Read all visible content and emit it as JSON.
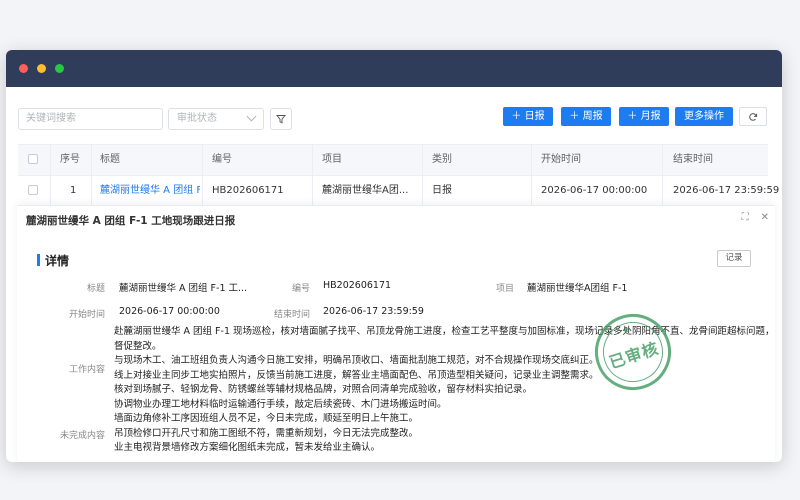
{
  "toolbar": {
    "search_placeholder": "关键词搜索",
    "status_placeholder": "审批状态",
    "btn_daily": "＋ 日报",
    "btn_weekly": "＋ 周报",
    "btn_monthly": "＋ 月报",
    "btn_more": "更多操作"
  },
  "table": {
    "headers": [
      "序号",
      "标题",
      "编号",
      "项目",
      "类别",
      "开始时间",
      "结束时间"
    ],
    "rows": [
      {
        "index": "1",
        "title": "麓湖丽世缦华 A 团组 F",
        "code": "HB202606171",
        "project": "麓湖丽世缦华A团...",
        "category": "日报",
        "start": "2026-06-17 00:00:00",
        "end": "2026-06-17 23:59:59"
      }
    ]
  },
  "panel": {
    "title": "麓湖丽世缦华 A 团组 F-1 工地现场跟进日报",
    "section": "详情",
    "record_button": "记录",
    "fields": {
      "title_label": "标题",
      "title_value": "麓湖丽世缦华 A 团组 F-1 工...",
      "code_label": "编号",
      "code_value": "HB202606171",
      "project_label": "项目",
      "project_value": "麓湖丽世缦华A团组 F-1",
      "start_label": "开始时间",
      "start_value": "2026-06-17 00:00:00",
      "end_label": "结束时间",
      "end_value": "2026-06-17 23:59:59",
      "content_label": "工作内容",
      "unfinished_label": "未完成内容"
    },
    "content_lines": [
      "赴麓湖丽世缦华 A 团组 F-1 现场巡检，核对墙面腻子找平、吊顶龙骨施工进度，检查工艺平整度与加固标准，现场记录多处阴阳角不直、龙骨间距超标问题，同步",
      "督促整改。",
      "与现场木工、油工班组负责人沟通今日施工安排，明确吊顶收口、墙面批刮施工规范，对不合规操作现场交底纠正。",
      "线上对接业主同步工地实拍照片，反馈当前施工进度，解答业主墙面配色、吊顶造型相关疑问，记录业主调整需求。",
      "核对到场腻子、轻钢龙骨、防锈螺丝等辅材规格品牌，对照合同清单完成验收，留存材料实拍记录。",
      "协调物业办理工地材料临时运输通行手续，敲定后续瓷砖、木门进场搬运时间。"
    ],
    "unfinished_lines": [
      "墙面边角修补工序因班组人员不足，今日未完成，顺延至明日上午施工。",
      "吊顶检修口开孔尺寸和施工图纸不符，需重新规划，今日无法完成整改。",
      "业主电视背景墙修改方案细化图纸未完成，暂未发给业主确认。"
    ],
    "stamp_text": "已审核"
  },
  "colors": {
    "titlebar": "#2f3d5a",
    "primary": "#1d7cf2",
    "stamp": "#3e9a60"
  }
}
